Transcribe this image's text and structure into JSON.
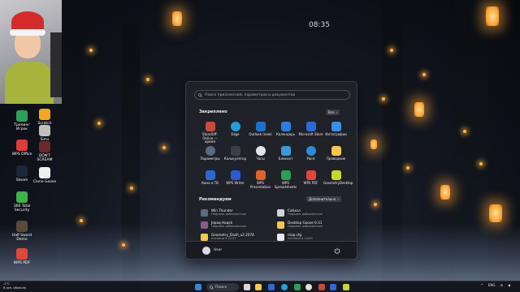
{
  "clock_overlay": "08:35",
  "desktop_icons": [
    {
      "label": "Тренинг Игрок",
      "icon": "app-icon",
      "color": "#2aa35a"
    },
    {
      "label": "WPS Office",
      "icon": "wps-icon",
      "color": "#e03a3a"
    },
    {
      "label": "Steam",
      "icon": "steam-icon",
      "color": "#1b2838"
    },
    {
      "label": "360 Total Security",
      "icon": "shield-icon",
      "color": "#3ab44a"
    },
    {
      "label": "Half Sword Demo",
      "icon": "game-icon",
      "color": "#5a4a3a"
    },
    {
      "label": "WPS PDF",
      "icon": "pdf-icon",
      "color": "#e0463a"
    }
  ],
  "desktop_icons_col2": [
    {
      "label": "Scratch",
      "icon": "scratch-icon",
      "color": "#f5a623"
    },
    {
      "label": "Sims",
      "icon": "game-icon",
      "color": "#c0c0c0"
    },
    {
      "label": "DON'T SCREAM",
      "icon": "game-icon",
      "color": "#6a2a2a"
    },
    {
      "label": "Clone Goose",
      "icon": "goose-icon",
      "color": "#f0f0f0"
    }
  ],
  "start_menu": {
    "search_placeholder": "Поиск приложений, параметров и документов",
    "pinned_title": "Закреплено",
    "all_button": "Все",
    "pinned_apps": [
      {
        "label": "StandOff: Online — время",
        "icon": "app-icon",
        "color": "#c84a3a"
      },
      {
        "label": "Edge",
        "icon": "edge-icon",
        "color": "#1fa0d8"
      },
      {
        "label": "Outlook (new)",
        "icon": "outlook-icon",
        "color": "#1a73c8"
      },
      {
        "label": "Календарь",
        "icon": "calendar-icon",
        "color": "#2f7ce0"
      },
      {
        "label": "Microsoft Store",
        "icon": "store-icon",
        "color": "#2b6ad8"
      },
      {
        "label": "Фотографии",
        "icon": "photos-icon",
        "color": "#3a8fe8"
      },
      {
        "label": "Параметры",
        "icon": "gear-icon",
        "color": "#5a6a80"
      },
      {
        "label": "Калькулятор",
        "icon": "calculator-icon",
        "color": "#3a3f48"
      },
      {
        "label": "Часы",
        "icon": "clock-icon",
        "color": "#dfe3ea"
      },
      {
        "label": "Блокнот",
        "icon": "notepad-icon",
        "color": "#3a9ad8"
      },
      {
        "label": "Paint",
        "icon": "paint-icon",
        "color": "#2a8cd8"
      },
      {
        "label": "Проводник",
        "icon": "folder-icon",
        "color": "#f4c84a"
      },
      {
        "label": "Кино и ТВ",
        "icon": "film-icon",
        "color": "#2a6ad0"
      },
      {
        "label": "WPS Writer",
        "icon": "wps-writer-icon",
        "color": "#2a5ad8"
      },
      {
        "label": "WPS Presentation",
        "icon": "wps-presentation-icon",
        "color": "#e0632a"
      },
      {
        "label": "WPS Spreadsheets",
        "icon": "wps-spreadsheets-icon",
        "color": "#2aa050"
      },
      {
        "label": "WPS PDF",
        "icon": "pdf-icon",
        "color": "#e0463a"
      },
      {
        "label": "GeometryDesktop",
        "icon": "geometry-icon",
        "color": "#c8d82a"
      }
    ],
    "recommended_title": "Рекомендуем",
    "more_button": "Дополнительно",
    "recommended": [
      {
        "title": "Win Thunder",
        "sub": "Недавно добавленные",
        "icon": "app-icon",
        "color": "#5a6a80"
      },
      {
        "title": "Сабхол",
        "sub": "Недавно добавленные",
        "icon": "app-icon",
        "color": "#cfd4dc"
      },
      {
        "title": "Jopaq Haqsk",
        "sub": "Недавно добавленные",
        "icon": "app-icon",
        "color": "#8a5a8a"
      },
      {
        "title": "Desktop Goose 0.31",
        "sub": "Недавно добавленные",
        "icon": "folder-icon",
        "color": "#f4c84a"
      },
      {
        "title": "Geometry_Dash_v2.2074",
        "sub": "пятница в 22:27",
        "icon": "folder-icon",
        "color": "#f4c84a"
      },
      {
        "title": "map.cfg",
        "sub": "пятница в 14:00",
        "icon": "file-icon",
        "color": "#e8ecf2"
      }
    ],
    "user_name": "User"
  },
  "taskbar": {
    "weather_temp": "-1°C",
    "weather_desc": "В осн. облачно",
    "search_label": "Поиск",
    "lang": "ENG",
    "time": "",
    "date": ""
  }
}
